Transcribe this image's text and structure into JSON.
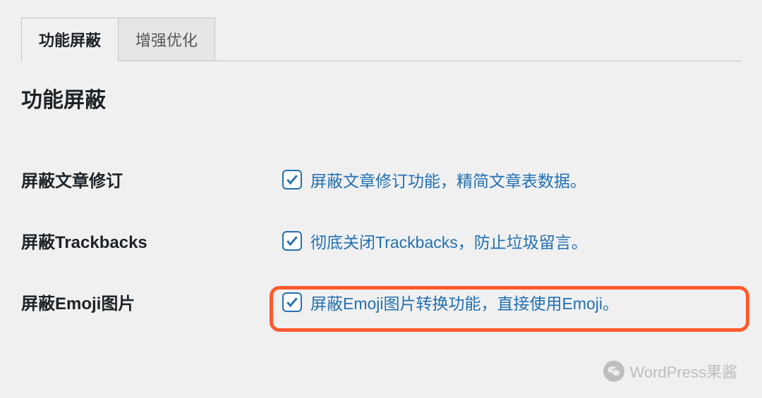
{
  "tabs": [
    {
      "label": "功能屏蔽",
      "active": true
    },
    {
      "label": "增强优化",
      "active": false
    }
  ],
  "section_title": "功能屏蔽",
  "settings": [
    {
      "label": "屏蔽文章修订",
      "checked": true,
      "description": "屏蔽文章修订功能，精简文章表数据。",
      "highlighted": false
    },
    {
      "label": "屏蔽Trackbacks",
      "checked": true,
      "description": "彻底关闭Trackbacks，防止垃圾留言。",
      "highlighted": false
    },
    {
      "label": "屏蔽Emoji图片",
      "checked": true,
      "description": "屏蔽Emoji图片转换功能，直接使用Emoji。",
      "highlighted": true
    }
  ],
  "watermark": "WordPress果酱"
}
